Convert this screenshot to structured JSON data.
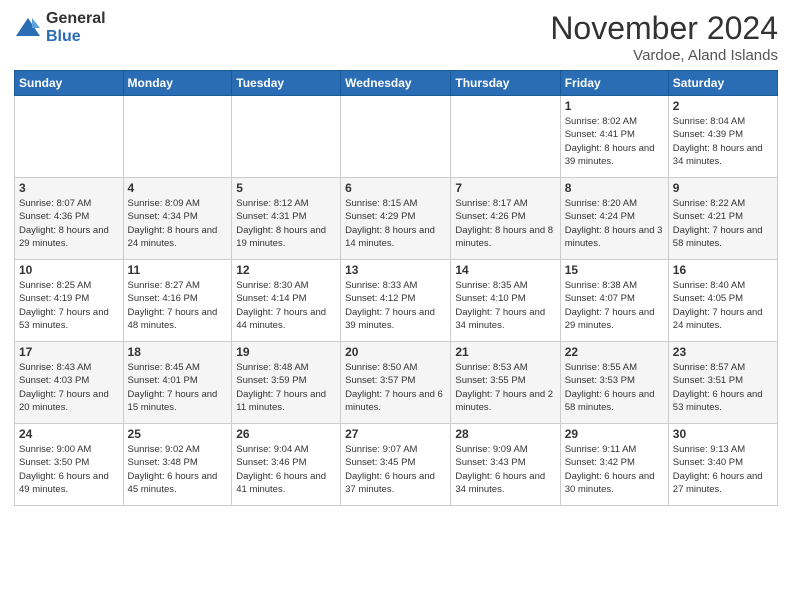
{
  "header": {
    "logo_general": "General",
    "logo_blue": "Blue",
    "month_title": "November 2024",
    "location": "Vardoe, Aland Islands"
  },
  "weekdays": [
    "Sunday",
    "Monday",
    "Tuesday",
    "Wednesday",
    "Thursday",
    "Friday",
    "Saturday"
  ],
  "weeks": [
    [
      {
        "day": "",
        "info": ""
      },
      {
        "day": "",
        "info": ""
      },
      {
        "day": "",
        "info": ""
      },
      {
        "day": "",
        "info": ""
      },
      {
        "day": "",
        "info": ""
      },
      {
        "day": "1",
        "info": "Sunrise: 8:02 AM\nSunset: 4:41 PM\nDaylight: 8 hours and 39 minutes."
      },
      {
        "day": "2",
        "info": "Sunrise: 8:04 AM\nSunset: 4:39 PM\nDaylight: 8 hours and 34 minutes."
      }
    ],
    [
      {
        "day": "3",
        "info": "Sunrise: 8:07 AM\nSunset: 4:36 PM\nDaylight: 8 hours and 29 minutes."
      },
      {
        "day": "4",
        "info": "Sunrise: 8:09 AM\nSunset: 4:34 PM\nDaylight: 8 hours and 24 minutes."
      },
      {
        "day": "5",
        "info": "Sunrise: 8:12 AM\nSunset: 4:31 PM\nDaylight: 8 hours and 19 minutes."
      },
      {
        "day": "6",
        "info": "Sunrise: 8:15 AM\nSunset: 4:29 PM\nDaylight: 8 hours and 14 minutes."
      },
      {
        "day": "7",
        "info": "Sunrise: 8:17 AM\nSunset: 4:26 PM\nDaylight: 8 hours and 8 minutes."
      },
      {
        "day": "8",
        "info": "Sunrise: 8:20 AM\nSunset: 4:24 PM\nDaylight: 8 hours and 3 minutes."
      },
      {
        "day": "9",
        "info": "Sunrise: 8:22 AM\nSunset: 4:21 PM\nDaylight: 7 hours and 58 minutes."
      }
    ],
    [
      {
        "day": "10",
        "info": "Sunrise: 8:25 AM\nSunset: 4:19 PM\nDaylight: 7 hours and 53 minutes."
      },
      {
        "day": "11",
        "info": "Sunrise: 8:27 AM\nSunset: 4:16 PM\nDaylight: 7 hours and 48 minutes."
      },
      {
        "day": "12",
        "info": "Sunrise: 8:30 AM\nSunset: 4:14 PM\nDaylight: 7 hours and 44 minutes."
      },
      {
        "day": "13",
        "info": "Sunrise: 8:33 AM\nSunset: 4:12 PM\nDaylight: 7 hours and 39 minutes."
      },
      {
        "day": "14",
        "info": "Sunrise: 8:35 AM\nSunset: 4:10 PM\nDaylight: 7 hours and 34 minutes."
      },
      {
        "day": "15",
        "info": "Sunrise: 8:38 AM\nSunset: 4:07 PM\nDaylight: 7 hours and 29 minutes."
      },
      {
        "day": "16",
        "info": "Sunrise: 8:40 AM\nSunset: 4:05 PM\nDaylight: 7 hours and 24 minutes."
      }
    ],
    [
      {
        "day": "17",
        "info": "Sunrise: 8:43 AM\nSunset: 4:03 PM\nDaylight: 7 hours and 20 minutes."
      },
      {
        "day": "18",
        "info": "Sunrise: 8:45 AM\nSunset: 4:01 PM\nDaylight: 7 hours and 15 minutes."
      },
      {
        "day": "19",
        "info": "Sunrise: 8:48 AM\nSunset: 3:59 PM\nDaylight: 7 hours and 11 minutes."
      },
      {
        "day": "20",
        "info": "Sunrise: 8:50 AM\nSunset: 3:57 PM\nDaylight: 7 hours and 6 minutes."
      },
      {
        "day": "21",
        "info": "Sunrise: 8:53 AM\nSunset: 3:55 PM\nDaylight: 7 hours and 2 minutes."
      },
      {
        "day": "22",
        "info": "Sunrise: 8:55 AM\nSunset: 3:53 PM\nDaylight: 6 hours and 58 minutes."
      },
      {
        "day": "23",
        "info": "Sunrise: 8:57 AM\nSunset: 3:51 PM\nDaylight: 6 hours and 53 minutes."
      }
    ],
    [
      {
        "day": "24",
        "info": "Sunrise: 9:00 AM\nSunset: 3:50 PM\nDaylight: 6 hours and 49 minutes."
      },
      {
        "day": "25",
        "info": "Sunrise: 9:02 AM\nSunset: 3:48 PM\nDaylight: 6 hours and 45 minutes."
      },
      {
        "day": "26",
        "info": "Sunrise: 9:04 AM\nSunset: 3:46 PM\nDaylight: 6 hours and 41 minutes."
      },
      {
        "day": "27",
        "info": "Sunrise: 9:07 AM\nSunset: 3:45 PM\nDaylight: 6 hours and 37 minutes."
      },
      {
        "day": "28",
        "info": "Sunrise: 9:09 AM\nSunset: 3:43 PM\nDaylight: 6 hours and 34 minutes."
      },
      {
        "day": "29",
        "info": "Sunrise: 9:11 AM\nSunset: 3:42 PM\nDaylight: 6 hours and 30 minutes."
      },
      {
        "day": "30",
        "info": "Sunrise: 9:13 AM\nSunset: 3:40 PM\nDaylight: 6 hours and 27 minutes."
      }
    ]
  ]
}
